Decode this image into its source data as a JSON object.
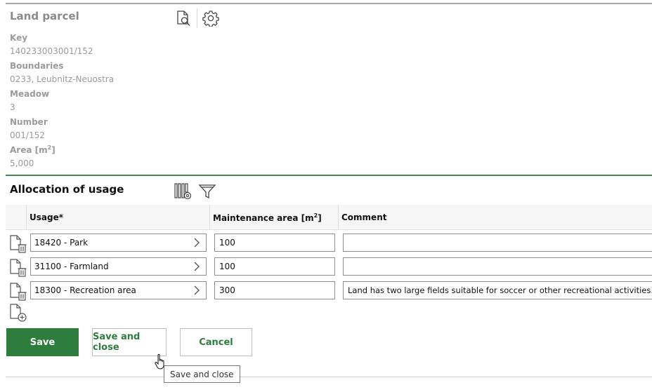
{
  "panel": {
    "title": "Land parcel",
    "fields": [
      {
        "label": "Key",
        "value": "140233003001/152"
      },
      {
        "label": "Boundaries",
        "value": "0233, Leubnitz-Neuostra"
      },
      {
        "label": "Meadow",
        "value": "3"
      },
      {
        "label": "Number",
        "value": "001/152"
      },
      {
        "label": "Area [m",
        "label_sup": "2",
        "label_suffix": "]",
        "value": "5,000"
      }
    ]
  },
  "allocation": {
    "title": "Allocation of usage",
    "columns": {
      "usage": "Usage*",
      "maintenance": "Maintenance area [m",
      "maintenance_sup": "2",
      "maintenance_suffix": "]",
      "comment": "Comment"
    },
    "rows": [
      {
        "usage": "18420 - Park",
        "maintenance": "100",
        "comment": ""
      },
      {
        "usage": "31100 - Farmland",
        "maintenance": "100",
        "comment": ""
      },
      {
        "usage": "18300 - Recreation area",
        "maintenance": "300",
        "comment": "Land has two large fields suitable for soccer or other recreational activities."
      }
    ]
  },
  "buttons": {
    "save": "Save",
    "save_and_close": "Save and close",
    "cancel": "Cancel"
  },
  "tooltip": "Save and close",
  "colors": {
    "primary_green": "#2e7d3f",
    "section_rule": "#3c8d50"
  },
  "icons": [
    "document-search-icon",
    "gear-icon",
    "column-settings-icon",
    "filter-icon",
    "delete-row-icon",
    "add-row-icon",
    "chevron-right-icon",
    "hand-cursor-icon"
  ]
}
